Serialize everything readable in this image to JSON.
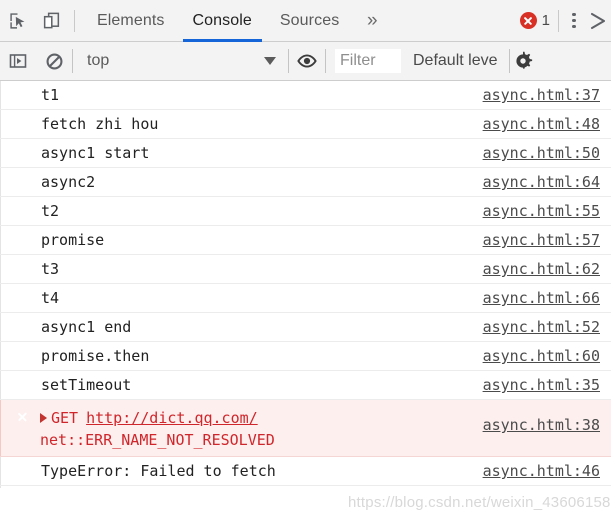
{
  "devtools": {
    "tabbar": {
      "inspect_icon": "inspect-element-icon",
      "device_icon": "device-toolbar-icon",
      "tabs": [
        {
          "label": "Elements",
          "selected": false
        },
        {
          "label": "Console",
          "selected": true
        },
        {
          "label": "Sources",
          "selected": false
        }
      ],
      "more_tabs_label": "»",
      "error_count": "1",
      "error_icon": "error-circle-icon",
      "kebab_icon": "more-options-icon",
      "close_icon": "close-icon"
    },
    "filterbar": {
      "sidebar_icon": "console-sidebar-icon",
      "clear_icon": "clear-console-icon",
      "context": "top",
      "context_caret_icon": "chevron-down-icon",
      "eye_icon": "live-expression-icon",
      "filter_placeholder": "Filter",
      "levels_label": "Default leve",
      "settings_icon": "gear-icon"
    },
    "console": {
      "rows": [
        {
          "message": "t1",
          "source": "async.html:37"
        },
        {
          "message": "fetch zhi hou",
          "source": "async.html:48"
        },
        {
          "message": "async1 start",
          "source": "async.html:50"
        },
        {
          "message": "async2",
          "source": "async.html:64"
        },
        {
          "message": "t2",
          "source": "async.html:55"
        },
        {
          "message": "promise",
          "source": "async.html:57"
        },
        {
          "message": "t3",
          "source": "async.html:62"
        },
        {
          "message": "t4",
          "source": "async.html:66"
        },
        {
          "message": "async1 end",
          "source": "async.html:52"
        },
        {
          "message": "promise.then",
          "source": "async.html:60"
        },
        {
          "message": "setTimeout",
          "source": "async.html:35"
        }
      ],
      "error_row": {
        "method": "GET",
        "url": "http://dict.qq.com/",
        "detail": "net::ERR_NAME_NOT_RESOLVED",
        "source": "async.html:38",
        "expand_icon": "expand-triangle-icon",
        "error_icon": "error-circle-icon"
      },
      "trailing_row": {
        "message": "TypeError: Failed to fetch",
        "source": "async.html:46"
      },
      "prompt_symbol": "❯"
    },
    "watermark": "https://blog.csdn.net/weixin_43606158",
    "colors": {
      "accent": "#1565d8",
      "error_red": "#d93025",
      "error_text": "#d0262b",
      "error_bg": "#fdefee",
      "toolbar_bg": "#f3f3f3",
      "link_gray": "#4b4b4b"
    }
  }
}
